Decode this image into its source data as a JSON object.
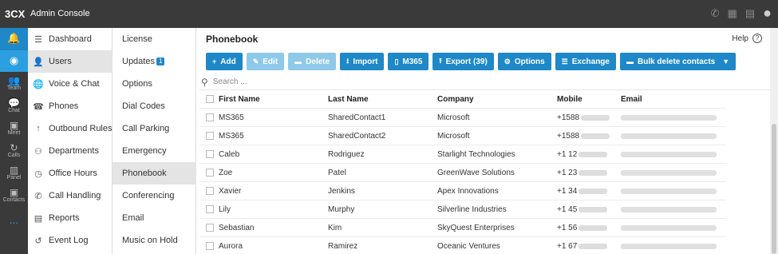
{
  "app": {
    "logo": "3CX",
    "title": "Admin Console"
  },
  "topbar_icons": [
    "phone-icon",
    "dialpad-icon",
    "book-icon",
    "user-icon"
  ],
  "rail": [
    {
      "icon": "bell-icon",
      "label": ""
    },
    {
      "icon": "chrome-icon",
      "label": ""
    },
    {
      "icon": "team-icon",
      "label": "Team"
    },
    {
      "icon": "chat-icon",
      "label": "Chat"
    },
    {
      "icon": "meet-icon",
      "label": "Meet"
    },
    {
      "icon": "calls-icon",
      "label": "Calls"
    },
    {
      "icon": "panel-icon",
      "label": "Panel"
    },
    {
      "icon": "contacts-icon",
      "label": "Contacts"
    },
    {
      "icon": "more-icon",
      "label": "..."
    }
  ],
  "nav1": [
    {
      "label": "Dashboard",
      "icon": "dashboard-icon"
    },
    {
      "label": "Users",
      "icon": "users-icon"
    },
    {
      "label": "Voice & Chat",
      "icon": "globe-icon"
    },
    {
      "label": "Phones",
      "icon": "phones-icon"
    },
    {
      "label": "Outbound Rules",
      "icon": "arrow-up-icon"
    },
    {
      "label": "Departments",
      "icon": "departments-icon"
    },
    {
      "label": "Office Hours",
      "icon": "clock-icon"
    },
    {
      "label": "Call Handling",
      "icon": "call-handling-icon"
    },
    {
      "label": "Reports",
      "icon": "reports-icon"
    },
    {
      "label": "Event Log",
      "icon": "event-log-icon"
    }
  ],
  "nav2": [
    {
      "label": "License"
    },
    {
      "label": "Updates",
      "badge": "1"
    },
    {
      "label": "Options"
    },
    {
      "label": "Dial Codes"
    },
    {
      "label": "Call Parking"
    },
    {
      "label": "Emergency"
    },
    {
      "label": "Phonebook"
    },
    {
      "label": "Conferencing"
    },
    {
      "label": "Email"
    },
    {
      "label": "Music on Hold"
    }
  ],
  "main": {
    "title": "Phonebook",
    "help": "Help",
    "toolbar": {
      "add": "Add",
      "edit": "Edit",
      "delete": "Delete",
      "import": "Import",
      "m365": "M365",
      "export": "Export (39)",
      "options": "Options",
      "exchange": "Exchange",
      "bulk_delete": "Bulk delete contacts"
    },
    "search_placeholder": "Search ...",
    "columns": {
      "first": "First Name",
      "last": "Last Name",
      "company": "Company",
      "mobile": "Mobile",
      "email": "Email"
    },
    "rows": [
      {
        "first": "MS365",
        "last": "SharedContact1",
        "company": "Microsoft",
        "mobile": "+1588"
      },
      {
        "first": "MS365",
        "last": "SharedContact2",
        "company": "Microsoft",
        "mobile": "+1588"
      },
      {
        "first": "Caleb",
        "last": "Rodriguez",
        "company": "Starlight Technologies",
        "mobile": "+1 12"
      },
      {
        "first": "Zoe",
        "last": "Patel",
        "company": "GreenWave Solutions",
        "mobile": "+1 23"
      },
      {
        "first": "Xavier",
        "last": "Jenkins",
        "company": "Apex Innovations",
        "mobile": "+1 34"
      },
      {
        "first": "Lily",
        "last": "Murphy",
        "company": "Silverline Industries",
        "mobile": "+1 45"
      },
      {
        "first": "Sebastian",
        "last": "Kim",
        "company": "SkyQuest Enterprises",
        "mobile": "+1 56"
      },
      {
        "first": "Aurora",
        "last": "Ramirez",
        "company": "Oceanic Ventures",
        "mobile": "+1 67"
      }
    ]
  }
}
